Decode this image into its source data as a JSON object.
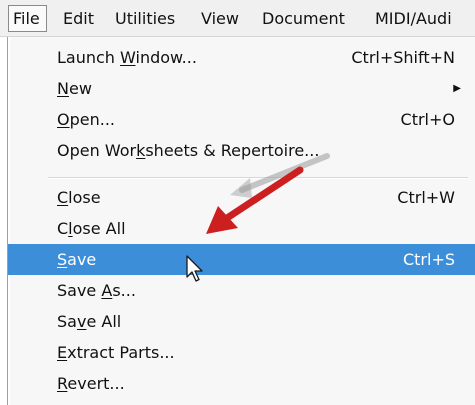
{
  "menubar": {
    "items": [
      {
        "label": "File",
        "open": true
      },
      {
        "label": "Edit"
      },
      {
        "label": "Utilities"
      },
      {
        "label": "View"
      },
      {
        "label": "Document"
      },
      {
        "label": "MIDI/Audi"
      }
    ]
  },
  "menu": {
    "items": [
      {
        "before": "Launch ",
        "u": "W",
        "after": "indow...",
        "shortcut": "Ctrl+Shift+N"
      },
      {
        "before": "",
        "u": "N",
        "after": "ew",
        "submenu": true
      },
      {
        "before": "",
        "u": "O",
        "after": "pen...",
        "shortcut": "Ctrl+O"
      },
      {
        "before": "Open Wor",
        "u": "k",
        "after": "sheets & Repertoire..."
      },
      {
        "before": "",
        "u": "C",
        "after": "lose",
        "shortcut": "Ctrl+W"
      },
      {
        "before": "C",
        "u": "l",
        "after": "ose All"
      },
      {
        "before": "",
        "u": "S",
        "after": "ave",
        "shortcut": "Ctrl+S",
        "highlighted": true
      },
      {
        "before": "Save ",
        "u": "A",
        "after": "s..."
      },
      {
        "before": "Sa",
        "u": "v",
        "after": "e All"
      },
      {
        "before": "",
        "u": "E",
        "after": "xtract Parts..."
      },
      {
        "before": "",
        "u": "R",
        "after": "evert..."
      }
    ]
  },
  "colors": {
    "highlight": "#3d8ed9",
    "annotation_arrow": "#cc1f1f"
  },
  "icons": {
    "submenu_arrow": "triangle-right-icon",
    "cursor": "mouse-pointer-icon",
    "annotation": "red-arrow-annotation"
  }
}
